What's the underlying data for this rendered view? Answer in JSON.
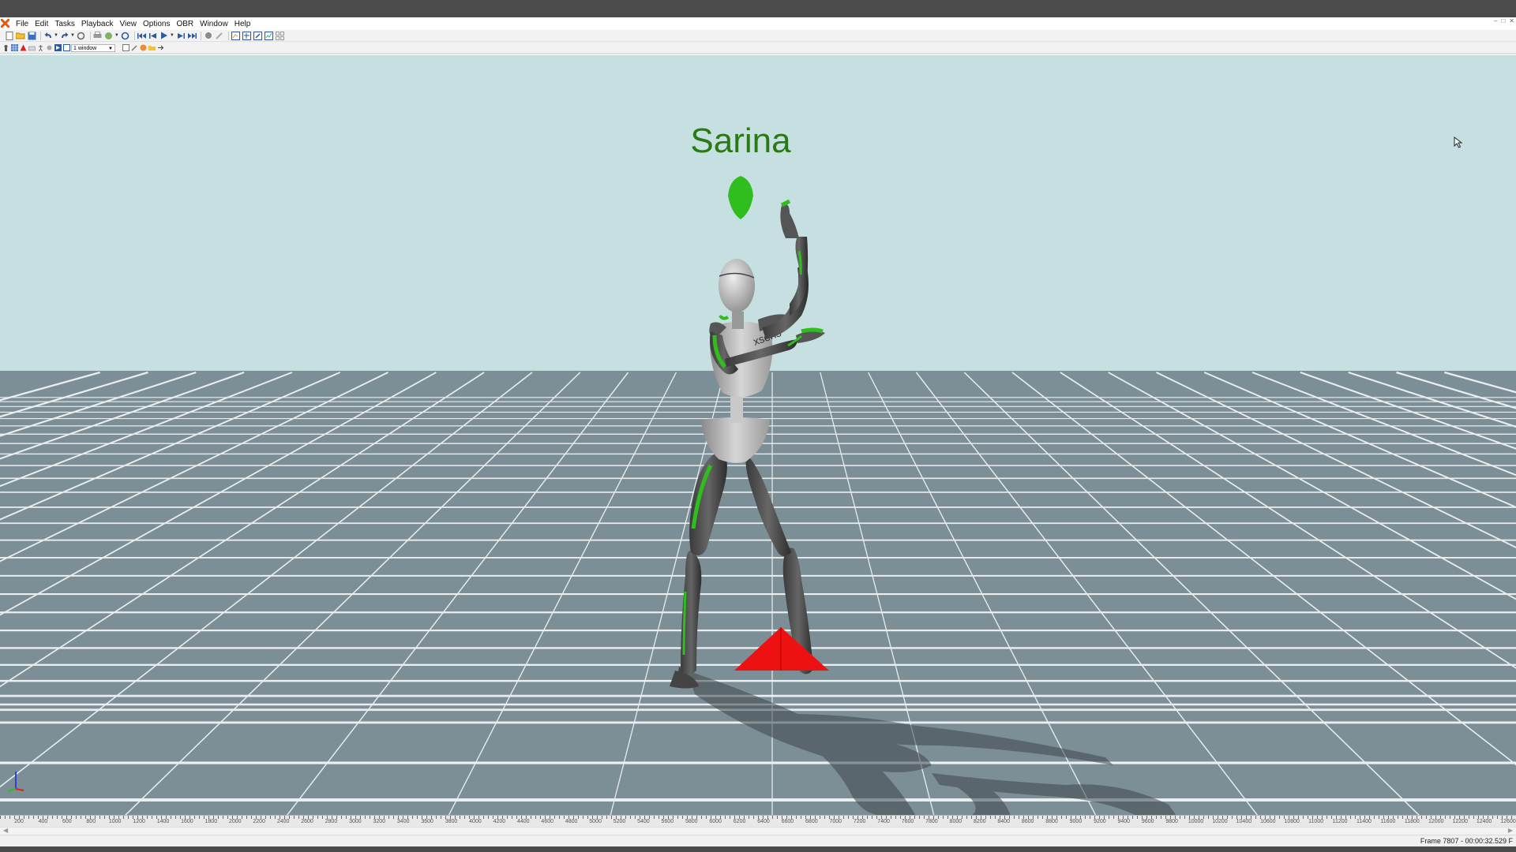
{
  "menu": {
    "items": [
      "File",
      "Edit",
      "Tasks",
      "Playback",
      "View",
      "Options",
      "OBR",
      "Window",
      "Help"
    ]
  },
  "window_controls": [
    "minimize-icon",
    "restore-icon",
    "close-icon"
  ],
  "toolbar": {
    "window_layout_select": "1 window"
  },
  "viewport": {
    "character_name": "Sarina",
    "suit_logo_text": "xsens",
    "sky_color": "#c6e0e1",
    "floor_color": "#7c8e96",
    "grid_color": "#e9eef0",
    "sensor_color": "#2fbe1d",
    "marker_color": "#ee1111"
  },
  "timeline": {
    "tick_labels": [
      "200",
      "400",
      "600",
      "800",
      "1000",
      "1200",
      "1400",
      "1600",
      "1800",
      "2000",
      "2200",
      "2400",
      "2600",
      "2800",
      "3000",
      "3200",
      "3400",
      "3600",
      "3800",
      "4000",
      "4200",
      "4400",
      "4600",
      "4800",
      "5000",
      "5200",
      "5400",
      "5600",
      "5800",
      "6000",
      "6200",
      "6400",
      "6600",
      "6800",
      "7000",
      "7200",
      "7400",
      "7600",
      "7800",
      "8000",
      "8200",
      "8400",
      "8600",
      "8800",
      "9000",
      "9200",
      "9400",
      "9600",
      "9800",
      "10000",
      "10200",
      "10400",
      "10600",
      "10800",
      "11000",
      "11200",
      "11400",
      "11600",
      "11800",
      "12000",
      "12200",
      "12400",
      "12600"
    ]
  },
  "status": {
    "frame_info": "Frame 7807 - 00:00:32.529 F"
  }
}
